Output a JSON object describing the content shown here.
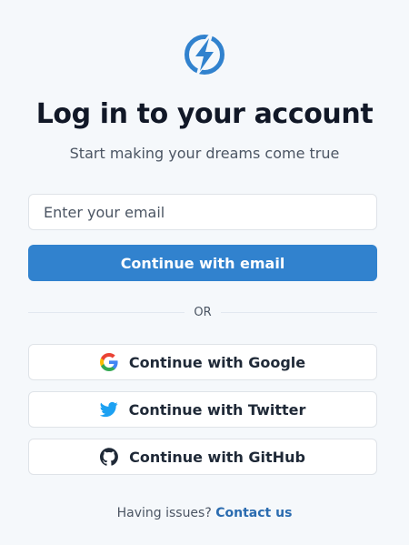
{
  "logo": {
    "icon": "lightning-bolt-icon",
    "color": "#3182ce"
  },
  "header": {
    "title": "Log in to your account",
    "subtitle": "Start making your dreams come true"
  },
  "email_form": {
    "placeholder": "Enter your email",
    "value": "",
    "submit_label": "Continue with email"
  },
  "divider": {
    "label": "OR"
  },
  "social": {
    "google": {
      "label": "Continue with Google",
      "icon": "google-icon"
    },
    "twitter": {
      "label": "Continue with Twitter",
      "icon": "twitter-icon"
    },
    "github": {
      "label": "Continue with GitHub",
      "icon": "github-icon"
    }
  },
  "footer": {
    "text": "Having issues?",
    "link": "Contact us"
  },
  "colors": {
    "accent": "#3182ce",
    "background": "#f5f8fb",
    "link": "#2b6cb0"
  }
}
